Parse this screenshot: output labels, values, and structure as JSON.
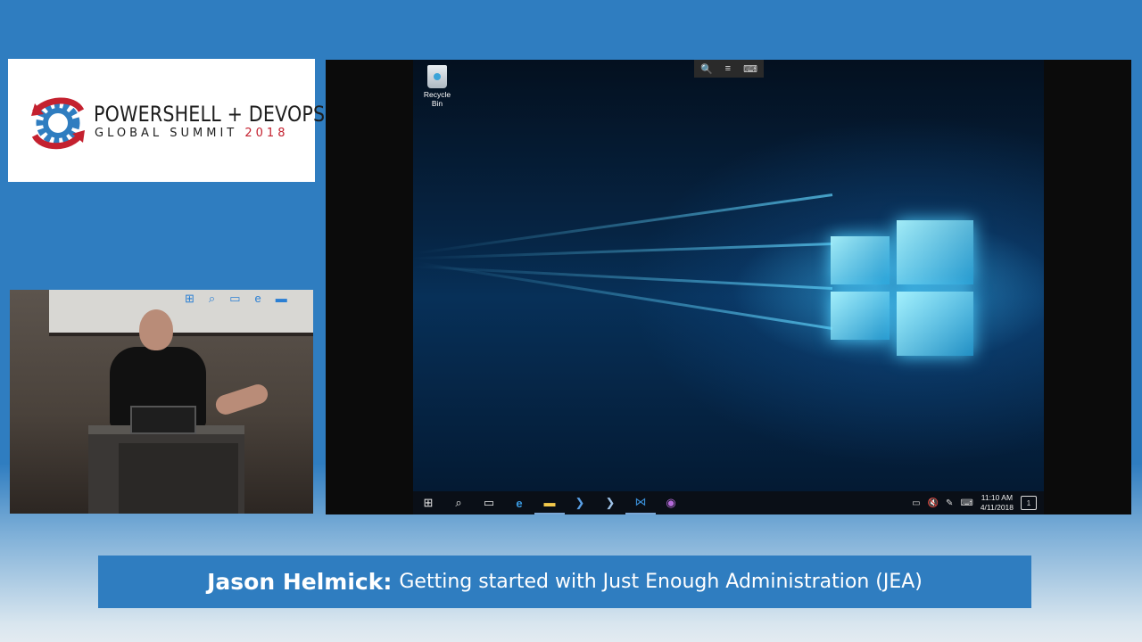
{
  "conference_logo": {
    "line1": "POWERSHELL + DEVOPS",
    "line2_text": "GLOBAL SUMMIT",
    "line2_year": "2018",
    "colors": {
      "red": "#c4212f",
      "blue": "#2f7dc0"
    }
  },
  "demo_screen": {
    "desktop_icons": [
      {
        "label": "Recycle Bin",
        "icon": "recycle-bin-icon"
      }
    ],
    "remote_toolbar": [
      {
        "icon": "zoom-icon",
        "glyph": "🔍"
      },
      {
        "icon": "menu-icon",
        "glyph": "≡"
      },
      {
        "icon": "keyboard-icon",
        "glyph": "⌨"
      }
    ],
    "taskbar": {
      "items": [
        {
          "name": "start-button",
          "glyph": "⊞"
        },
        {
          "name": "search-button",
          "glyph": "⌕"
        },
        {
          "name": "task-view-button",
          "glyph": "▭"
        },
        {
          "name": "edge-icon",
          "glyph": "e"
        },
        {
          "name": "file-explorer-icon",
          "glyph": "▬"
        },
        {
          "name": "powershell-icon",
          "glyph": "❯"
        },
        {
          "name": "powershell-admin-icon",
          "glyph": "❯"
        },
        {
          "name": "vscode-icon",
          "glyph": "⋈"
        },
        {
          "name": "app-icon",
          "glyph": "◉"
        }
      ],
      "tray": {
        "time": "11:10 AM",
        "date": "4/11/2018",
        "notification_count": "1"
      }
    }
  },
  "caption": {
    "speaker": "Jason Helmick:",
    "title": "Getting started with Just Enough Administration (JEA)"
  }
}
